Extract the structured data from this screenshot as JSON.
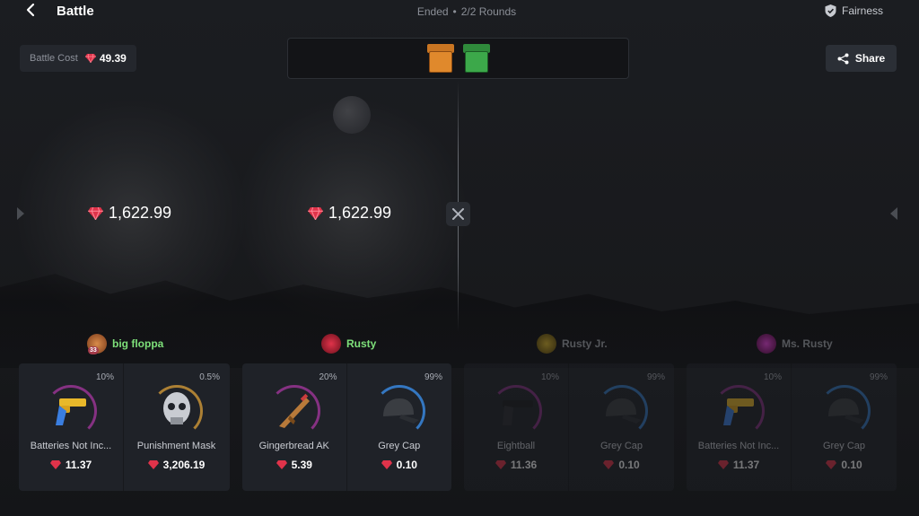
{
  "header": {
    "title": "Battle",
    "status": "Ended",
    "rounds": "2/2 Rounds",
    "fairness_label": "Fairness"
  },
  "battle_cost": {
    "label": "Battle Cost",
    "value": "49.39"
  },
  "share_label": "Share",
  "cases": [
    {
      "name": "orange-case",
      "color": "#e0892c"
    },
    {
      "name": "green-case",
      "color": "#3ca84a"
    }
  ],
  "totals": [
    "1,622.99",
    "1,622.99"
  ],
  "players": [
    {
      "name": "big floppa",
      "color": "#7ee07a",
      "level": "33",
      "active": true
    },
    {
      "name": "Rusty",
      "color": "#7ee07a",
      "level": "",
      "active": true
    },
    {
      "name": "Rusty Jr.",
      "color": "#8a8d93",
      "level": "",
      "active": false
    },
    {
      "name": "Ms. Rusty",
      "color": "#8a8d93",
      "level": "",
      "active": false
    }
  ],
  "item_groups": [
    [
      {
        "chance": "10%",
        "name": "Batteries Not Inc...",
        "price": "11.37",
        "ring": "#c93cbf",
        "icon": "revolver-icon"
      },
      {
        "chance": "0.5%",
        "name": "Punishment Mask",
        "price": "3,206.19",
        "ring": "#e8a93a",
        "icon": "skull-mask-icon"
      }
    ],
    [
      {
        "chance": "20%",
        "name": "Gingerbread AK",
        "price": "5.39",
        "ring": "#c93cbf",
        "icon": "rifle-icon"
      },
      {
        "chance": "99%",
        "name": "Grey Cap",
        "price": "0.10",
        "ring": "#3a8de8",
        "icon": "cap-icon"
      }
    ],
    [
      {
        "chance": "10%",
        "name": "Eightball",
        "price": "11.36",
        "ring": "#c93cbf",
        "icon": "pistol-icon"
      },
      {
        "chance": "99%",
        "name": "Grey Cap",
        "price": "0.10",
        "ring": "#3a8de8",
        "icon": "cap-icon"
      }
    ],
    [
      {
        "chance": "10%",
        "name": "Batteries Not Inc...",
        "price": "11.37",
        "ring": "#c93cbf",
        "icon": "revolver-icon"
      },
      {
        "chance": "99%",
        "name": "Grey Cap",
        "price": "0.10",
        "ring": "#3a8de8",
        "icon": "cap-icon"
      }
    ]
  ],
  "colors": {
    "gem": "#e0334a",
    "accent_green": "#7ee07a"
  }
}
